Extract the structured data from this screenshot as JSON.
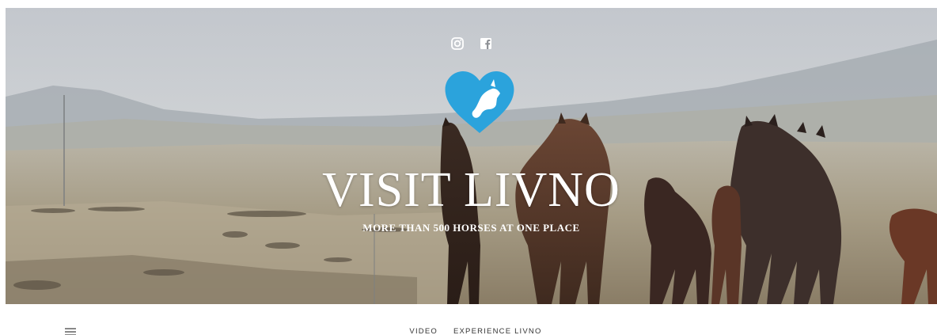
{
  "header": {
    "social": [
      {
        "name": "instagram-icon",
        "label": "Instagram"
      },
      {
        "name": "facebook-icon",
        "label": "Facebook"
      }
    ],
    "logo_icon": "heart-horse-logo-icon",
    "title": "VISIT LIVNO",
    "tagline": "MORE THAN 500 HORSES AT ONE PLACE"
  },
  "nav": {
    "menu_icon": "hamburger-menu-icon",
    "items": [
      {
        "label": "VIDEO"
      },
      {
        "label": "EXPERIENCE LIVNO"
      }
    ]
  },
  "colors": {
    "logo": "#2ba3dc",
    "title_text": "#ffffff",
    "nav_text": "#333333"
  }
}
